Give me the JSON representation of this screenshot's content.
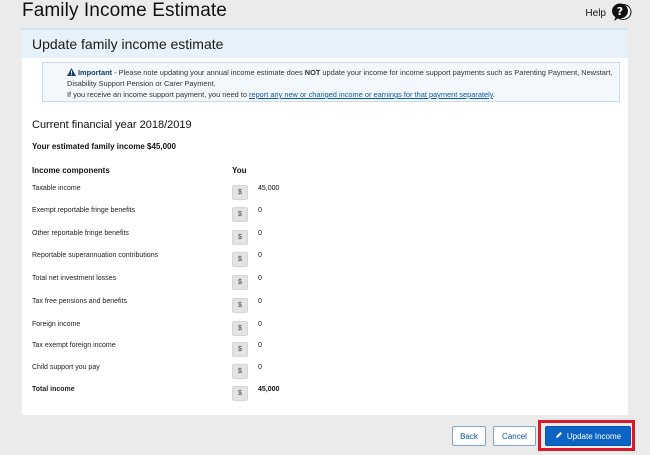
{
  "page": {
    "title": "Family Income Estimate"
  },
  "help": {
    "label": "Help",
    "icon": "question-bubble-icon"
  },
  "panel": {
    "header": "Update family income estimate"
  },
  "notice": {
    "lead": "Important",
    "text1": " - Please note updating your annual income estimate does ",
    "emphasis": "NOT",
    "text2": " update your income for income support payments such as Parenting Payment, Newstart, Disability Support Pension or Carer Payment.",
    "text3": "If you receive an income support payment, you need to ",
    "link": "report any new or changed income or earnings for that payment separately",
    "text4": "."
  },
  "financial_year": "Current financial year 2018/2019",
  "estimated_income": "Your estimated family income $45,000",
  "columns": {
    "components": "Income components",
    "you": "You"
  },
  "currency_symbol": "$",
  "rows": [
    {
      "label": "Taxable income",
      "value": "45,000"
    },
    {
      "label": "Exempt reportable fringe benefits",
      "value": "0"
    },
    {
      "label": "Other reportable fringe benefits",
      "value": "0"
    },
    {
      "label": "Reportable superannuation contributions",
      "value": "0"
    },
    {
      "label": "Total net investment losses",
      "value": "0"
    },
    {
      "label": "Tax free pensions and benefits",
      "value": "0"
    },
    {
      "label": "Foreign income",
      "value": "0"
    },
    {
      "label": "Tax exempt foreign income",
      "value": "0"
    },
    {
      "label": "Child support you pay",
      "value": "0"
    },
    {
      "label": "Total income",
      "value": "45,000"
    }
  ],
  "buttons": {
    "back": "Back",
    "cancel": "Cancel",
    "update": "Update Income"
  },
  "colors": {
    "primary": "#0b63c4",
    "highlight": "#d8192a",
    "header_bg": "#e7f1f9"
  }
}
